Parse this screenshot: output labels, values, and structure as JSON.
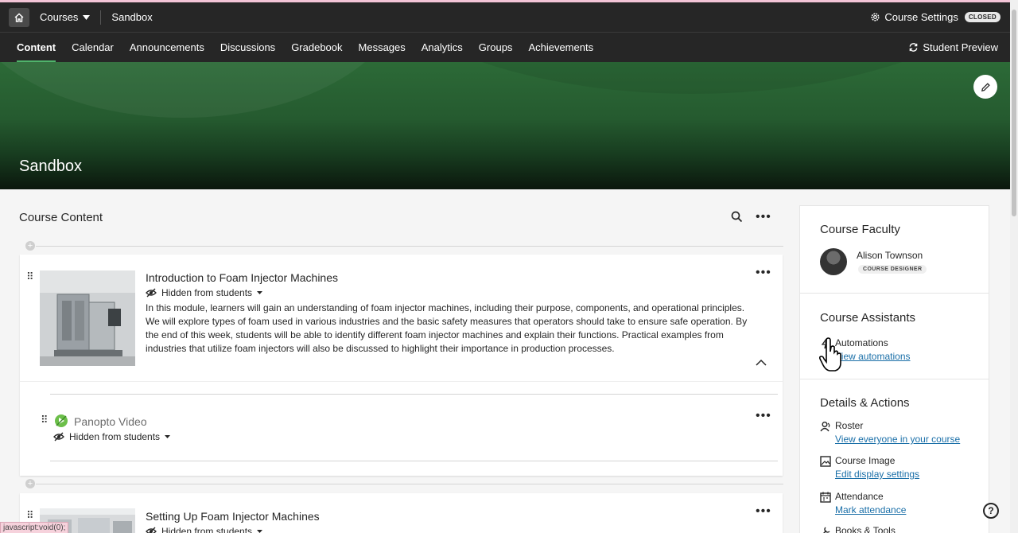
{
  "topbar": {
    "courses_label": "Courses",
    "breadcrumb": "Sandbox",
    "course_settings": "Course Settings",
    "status_badge": "CLOSED"
  },
  "nav": {
    "tabs": [
      "Content",
      "Calendar",
      "Announcements",
      "Discussions",
      "Gradebook",
      "Messages",
      "Analytics",
      "Groups",
      "Achievements"
    ],
    "active_tab": "Content",
    "student_preview": "Student Preview"
  },
  "banner": {
    "title": "Sandbox"
  },
  "content": {
    "heading": "Course Content",
    "items": [
      {
        "title": "Introduction to Foam Injector Machines",
        "visibility": "Hidden from students",
        "description": "In this module, learners will gain an understanding of foam injector machines, including their purpose, components, and operational principles. We will explore types of foam used in various industries and the basic safety measures that operators should take to ensure safe operation. By the end of this week, students will be able to identify different foam injector machines and explain their functions. Practical examples from industries that utilize foam injectors will also be discussed to highlight their importance in production processes."
      },
      {
        "title": "Panopto Video",
        "visibility": "Hidden from students"
      },
      {
        "title": "Setting Up Foam Injector Machines",
        "visibility": "Hidden from students"
      }
    ]
  },
  "sidebar": {
    "faculty_heading": "Course Faculty",
    "faculty_name": "Alison Townson",
    "faculty_role": "COURSE DESIGNER",
    "assistants_heading": "Course Assistants",
    "automations_label": "Automations",
    "automations_link": "View automations",
    "details_heading": "Details & Actions",
    "roster_label": "Roster",
    "roster_link": "View everyone in your course",
    "image_label": "Course Image",
    "image_link": "Edit display settings",
    "attendance_label": "Attendance",
    "attendance_link": "Mark attendance",
    "books_label": "Books & Tools"
  },
  "help": "?",
  "status_url": "javascript:void(0);",
  "colors": {
    "accent": "#4fb36b",
    "link": "#1a6fa8",
    "dark_nav": "#262626"
  }
}
